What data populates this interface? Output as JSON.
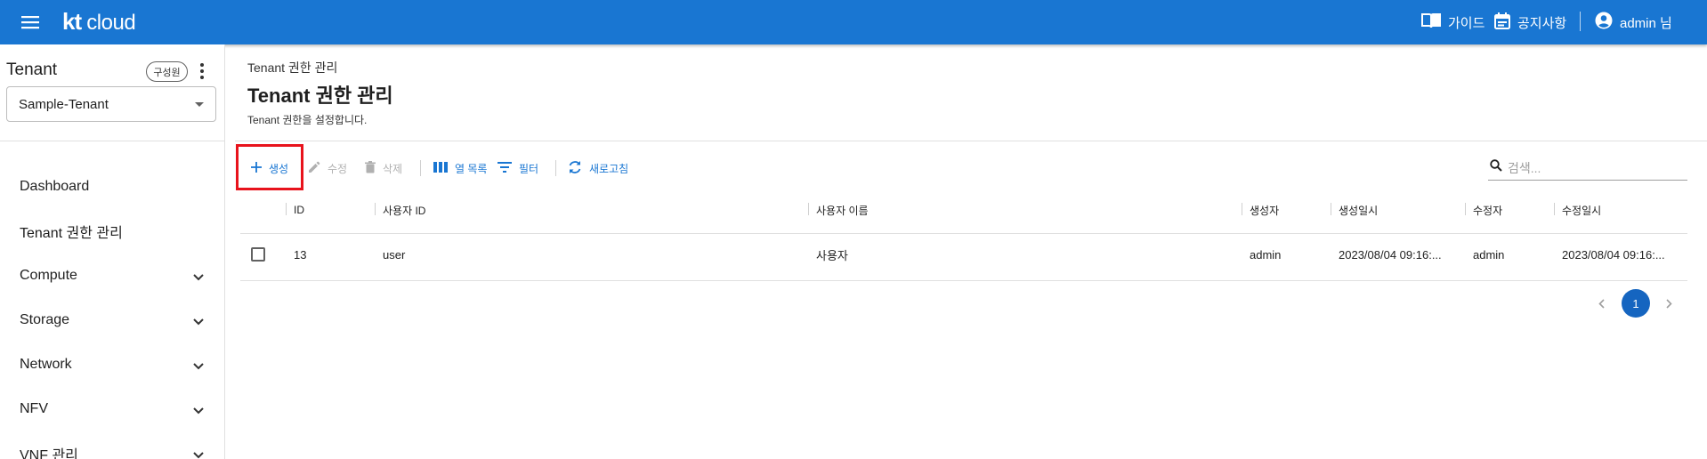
{
  "header": {
    "logo_kt": "kt",
    "logo_cloud": "cloud",
    "guide_label": "가이드",
    "notice_label": "공지사항",
    "user_label": "admin 님",
    "bg_color": "#1976d2"
  },
  "sidebar": {
    "title": "Tenant",
    "role_chip": "구성원",
    "tenant_value": "Sample-Tenant",
    "items": [
      {
        "label": "Dashboard",
        "expandable": false
      },
      {
        "label": "Tenant 권한 관리",
        "expandable": false
      },
      {
        "label": "Compute",
        "expandable": true
      },
      {
        "label": "Storage",
        "expandable": true
      },
      {
        "label": "Network",
        "expandable": true
      },
      {
        "label": "NFV",
        "expandable": true
      },
      {
        "label": "VNF 관리",
        "expandable": true
      }
    ]
  },
  "page": {
    "breadcrumb": "Tenant 권한 관리",
    "title": "Tenant 권한 관리",
    "description": "Tenant 권한을 설정합니다."
  },
  "toolbar": {
    "create_label": "생성",
    "edit_label": "수정",
    "delete_label": "삭제",
    "columns_label": "열 목록",
    "filter_label": "필터",
    "refresh_label": "새로고침",
    "search_placeholder": "검색...",
    "accent_color": "#1976d2",
    "highlight_color": "#e8131c"
  },
  "table": {
    "columns": [
      "ID",
      "사용자 ID",
      "사용자 이름",
      "생성자",
      "생성일시",
      "수정자",
      "수정일시"
    ],
    "rows": [
      [
        "13",
        "user",
        "사용자",
        "admin",
        "2023/08/04 09:16:...",
        "admin",
        "2023/08/04 09:16:..."
      ]
    ]
  },
  "pagination": {
    "current_page": "1"
  }
}
